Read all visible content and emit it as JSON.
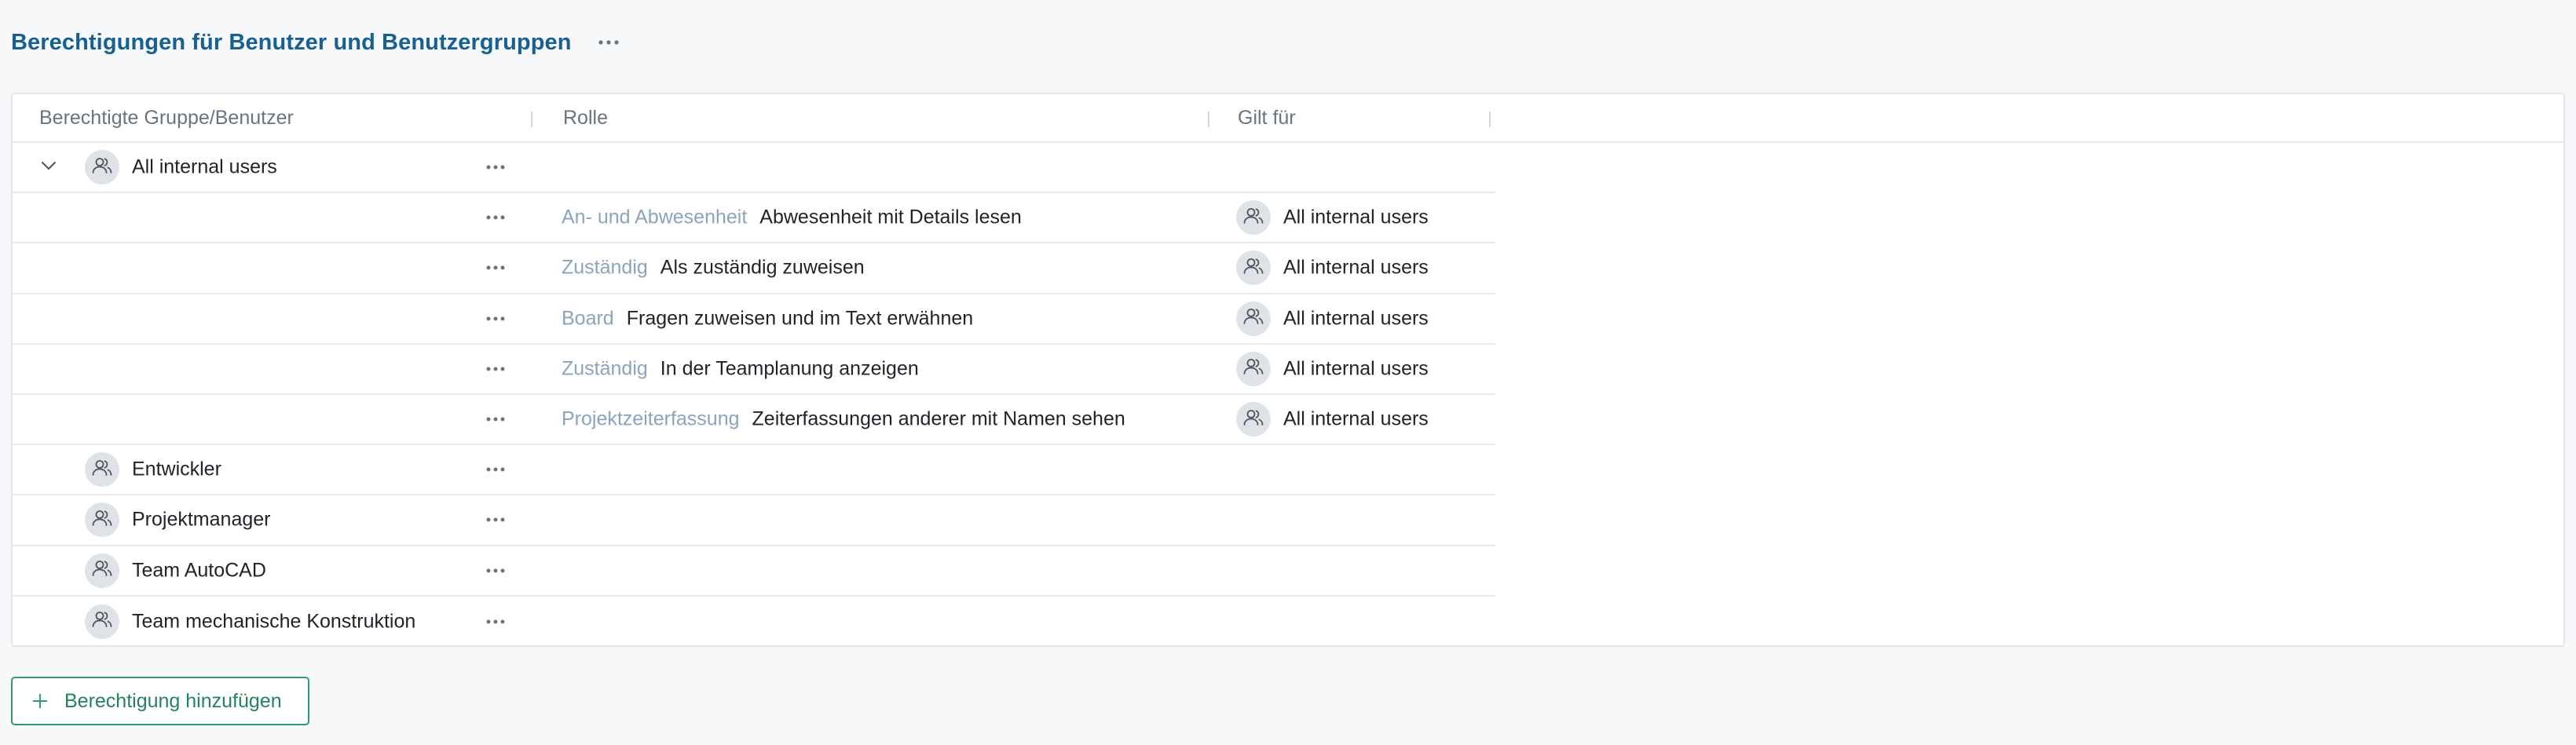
{
  "header": {
    "title": "Berechtigungen für Benutzer und Benutzergruppen"
  },
  "table": {
    "columns": {
      "group": "Berechtigte Gruppe/Benutzer",
      "role": "Rolle",
      "applies_to": "Gilt für"
    },
    "groups": [
      {
        "name": "All internal users",
        "expanded": true,
        "roles": [
          {
            "category": "An- und Abwesenheit",
            "name": "Abwesenheit mit Details lesen",
            "applies_to": "All internal users"
          },
          {
            "category": "Zuständig",
            "name": "Als zuständig zuweisen",
            "applies_to": "All internal users"
          },
          {
            "category": "Board",
            "name": "Fragen zuweisen und im Text erwähnen",
            "applies_to": "All internal users"
          },
          {
            "category": "Zuständig",
            "name": "In der Teamplanung anzeigen",
            "applies_to": "All internal users"
          },
          {
            "category": "Projektzeiterfassung",
            "name": "Zeiterfassungen anderer mit Namen sehen",
            "applies_to": "All internal users"
          }
        ]
      },
      {
        "name": "Entwickler"
      },
      {
        "name": "Projektmanager"
      },
      {
        "name": "Team AutoCAD"
      },
      {
        "name": "Team mechanische Konstruktion"
      }
    ]
  },
  "add_button": {
    "label": "Berechtigung hinzufügen"
  },
  "colors": {
    "title": "#17608f",
    "role_category": "#8aa3bf",
    "add_button": "#2f9c6e",
    "avatar_bg": "#dfe2e7"
  },
  "icons": {
    "more": "more-horizontal-icon",
    "group": "users-icon",
    "expand": "chevron-down-icon",
    "add": "plus-icon"
  }
}
